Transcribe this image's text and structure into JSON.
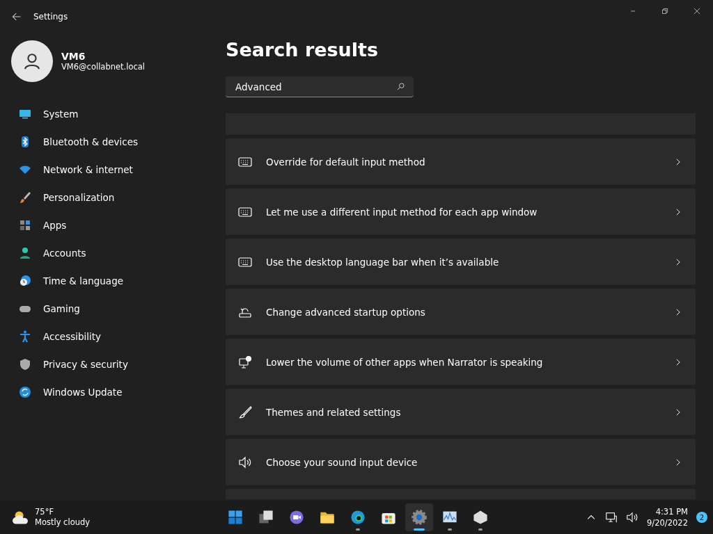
{
  "window": {
    "title": "Settings"
  },
  "account": {
    "name": "VM6",
    "email": "VM6@collabnet.local"
  },
  "sidebar": {
    "items": [
      {
        "label": "System"
      },
      {
        "label": "Bluetooth & devices"
      },
      {
        "label": "Network & internet"
      },
      {
        "label": "Personalization"
      },
      {
        "label": "Apps"
      },
      {
        "label": "Accounts"
      },
      {
        "label": "Time & language"
      },
      {
        "label": "Gaming"
      },
      {
        "label": "Accessibility"
      },
      {
        "label": "Privacy & security"
      },
      {
        "label": "Windows Update"
      }
    ]
  },
  "main": {
    "heading": "Search results",
    "search": {
      "value": "Advanced"
    },
    "results": [
      {
        "label": "Override for default input method"
      },
      {
        "label": "Let me use a different input method for each app window"
      },
      {
        "label": "Use the desktop language bar when it’s available"
      },
      {
        "label": "Change advanced startup options"
      },
      {
        "label": "Lower the volume of other apps when Narrator is speaking"
      },
      {
        "label": "Themes and related settings"
      },
      {
        "label": "Choose your sound input device"
      }
    ]
  },
  "taskbar": {
    "weather": {
      "temp": "75°F",
      "condition": "Mostly cloudy"
    },
    "apps": [
      {
        "kind": "start",
        "running": false,
        "selected": false
      },
      {
        "kind": "taskview",
        "running": false,
        "selected": false
      },
      {
        "kind": "chat",
        "running": false,
        "selected": false
      },
      {
        "kind": "explorer",
        "running": false,
        "selected": false
      },
      {
        "kind": "edge",
        "running": true,
        "selected": false
      },
      {
        "kind": "store",
        "running": false,
        "selected": false
      },
      {
        "kind": "settings",
        "running": true,
        "selected": true
      },
      {
        "kind": "monitor",
        "running": true,
        "selected": false
      },
      {
        "kind": "cube",
        "running": true,
        "selected": false
      }
    ],
    "time": "4:31 PM",
    "date": "9/20/2022",
    "notifications": "2"
  }
}
